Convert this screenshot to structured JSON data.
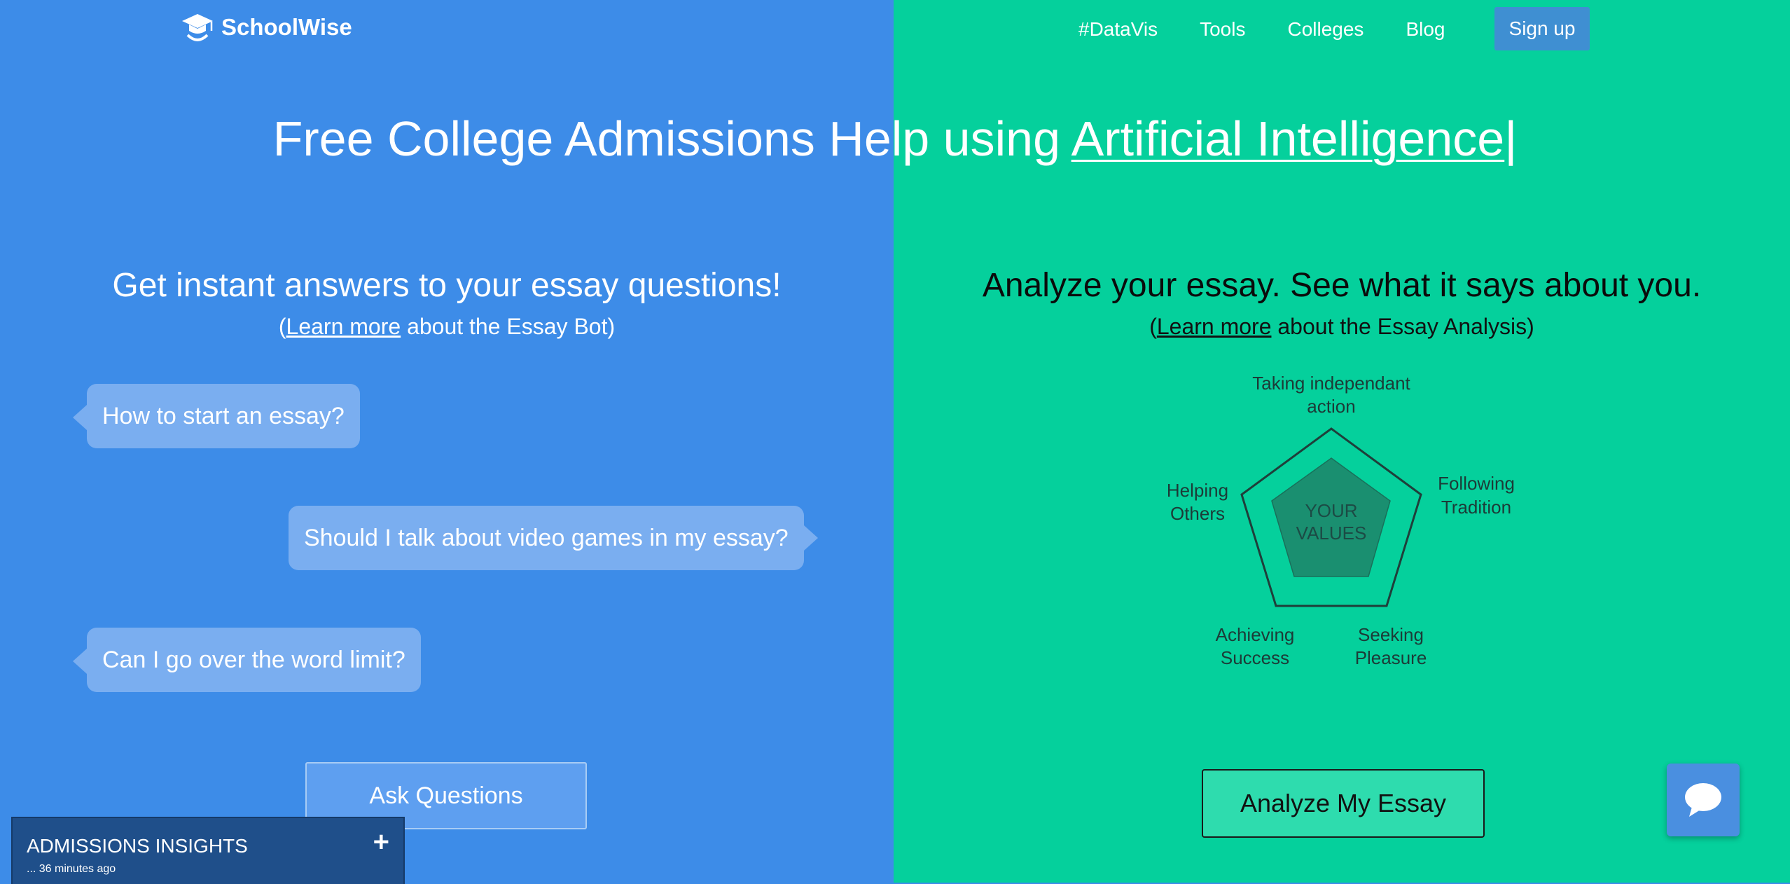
{
  "brand": {
    "name": "SchoolWise",
    "icon": "graduation-cap-icon"
  },
  "nav": {
    "items": [
      "#DataVis",
      "Tools",
      "Colleges",
      "Blog"
    ],
    "signup": "Sign up"
  },
  "hero": {
    "prefix": "Free College Admissions Help using ",
    "highlight": "Artificial Intelligence",
    "caret": "|"
  },
  "left": {
    "heading": "Get instant answers to your essay questions!",
    "sub_open": "(",
    "sub_link": "Learn more",
    "sub_rest": " about the Essay Bot)",
    "questions": [
      "How to start an essay?",
      "Should I talk about video games in my essay?",
      "Can I go over the word limit?"
    ],
    "button": "Ask Questions"
  },
  "right": {
    "heading": "Analyze your essay. See what it says about you.",
    "sub_open": "(",
    "sub_link": "Learn more",
    "sub_rest": " about the Essay Analysis)",
    "radar": {
      "labels": {
        "top1": "Taking independant",
        "top2": "action",
        "right1": "Following",
        "right2": "Tradition",
        "left1": "Helping",
        "left2": "Others",
        "bl1": "Achieving",
        "bl2": "Success",
        "br1": "Seeking",
        "br2": "Pleasure"
      },
      "center1": "YOUR",
      "center2": "VALUES"
    },
    "button": "Analyze My Essay"
  },
  "insights": {
    "title": "ADMISSIONS INSIGHTS",
    "time": "... 36 minutes ago",
    "toggle": "+"
  },
  "chat": {
    "icon": "chat-bubble-icon"
  },
  "colors": {
    "left_bg": "#3d8ce8",
    "right_bg": "#05d09c",
    "bubble": "#7aaef0"
  }
}
